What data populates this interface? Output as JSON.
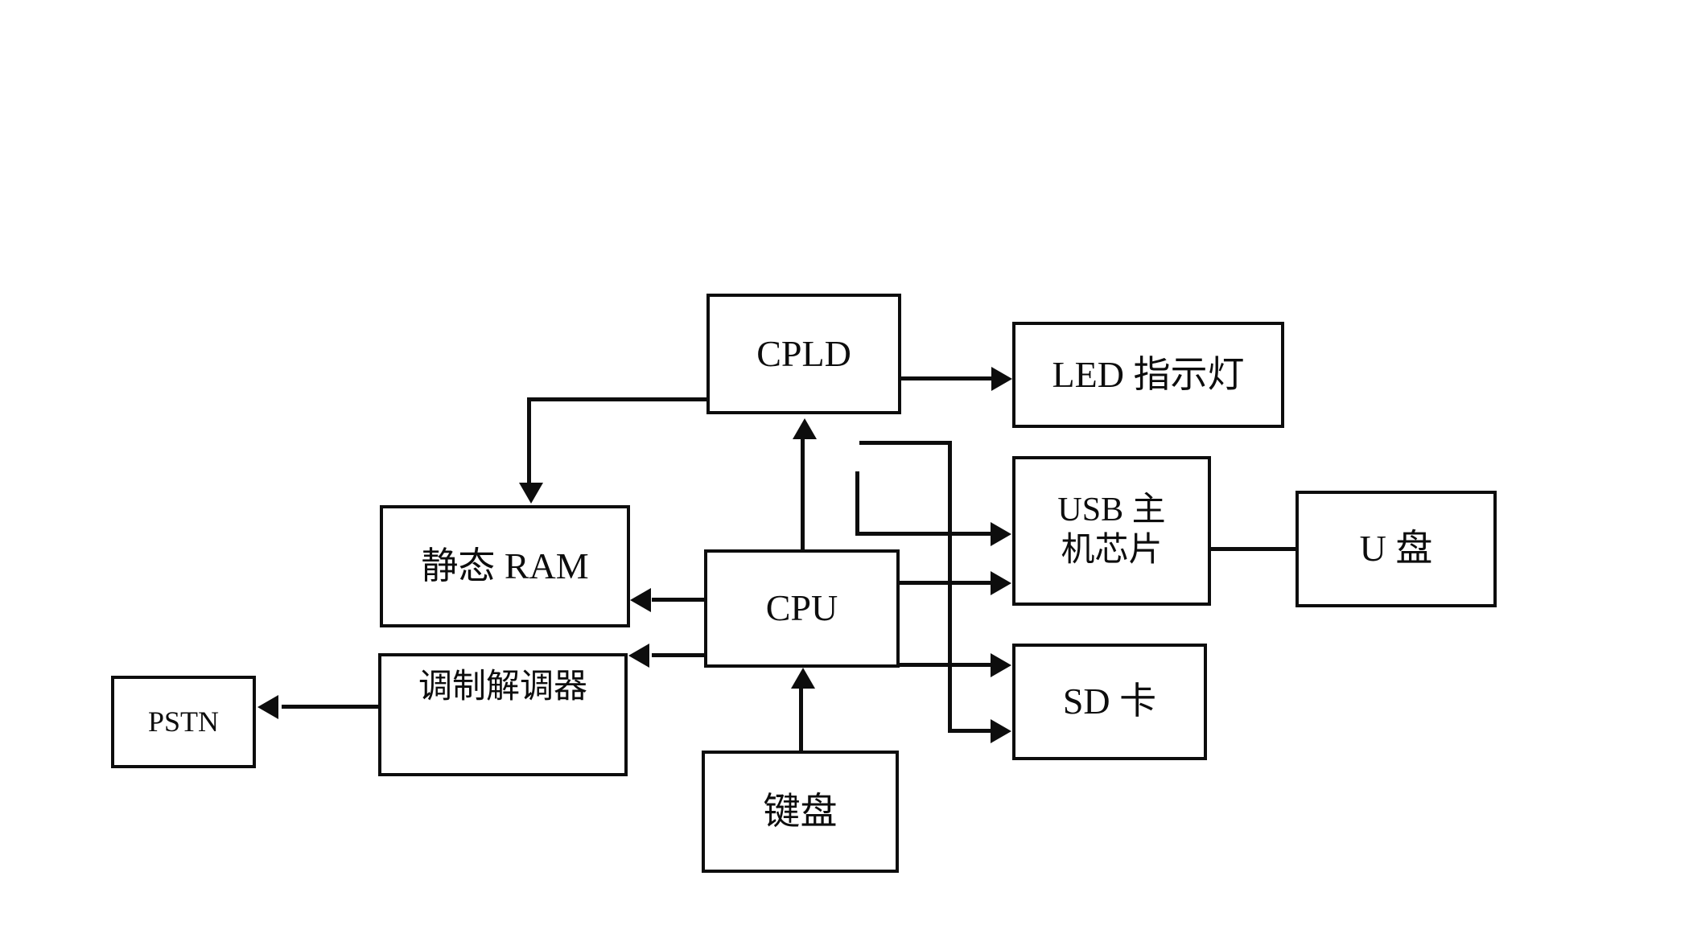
{
  "diagram": {
    "title": "",
    "type": "block-diagram",
    "background_color": "#ffffff",
    "line_color": "#0d0d0d",
    "nodes": [
      {
        "id": "cpld",
        "label": "CPLD"
      },
      {
        "id": "led",
        "label": "LED 指示灯"
      },
      {
        "id": "sram",
        "label": "静态 RAM"
      },
      {
        "id": "cpu",
        "label": "CPU"
      },
      {
        "id": "usb",
        "label": "USB 主\n机芯片"
      },
      {
        "id": "udisk",
        "label": "U 盘"
      },
      {
        "id": "sd",
        "label": "SD 卡"
      },
      {
        "id": "modem",
        "label": "调制解调器"
      },
      {
        "id": "pstn",
        "label": "PSTN"
      },
      {
        "id": "keyboard",
        "label": "键盘"
      }
    ],
    "edges": [
      {
        "from": "cpld",
        "to": "led",
        "arrow": "right"
      },
      {
        "from": "cpld",
        "to": "sram",
        "arrow": "down"
      },
      {
        "from": "cpu",
        "to": "cpld",
        "arrow": "up"
      },
      {
        "from": "cpu",
        "to": "sram",
        "arrow": "left"
      },
      {
        "from": "cpu",
        "to": "modem",
        "arrow": "left"
      },
      {
        "from": "cpu",
        "to": "usb",
        "arrow": "right"
      },
      {
        "from": "cpu",
        "to": "sd",
        "arrow": "right"
      },
      {
        "from": "bus",
        "to": "usb",
        "arrow": "right"
      },
      {
        "from": "bus",
        "to": "sd",
        "arrow": "right"
      },
      {
        "from": "usb",
        "to": "udisk",
        "arrow": "none"
      },
      {
        "from": "modem",
        "to": "pstn",
        "arrow": "left"
      },
      {
        "from": "keyboard",
        "to": "cpu",
        "arrow": "up"
      }
    ]
  }
}
